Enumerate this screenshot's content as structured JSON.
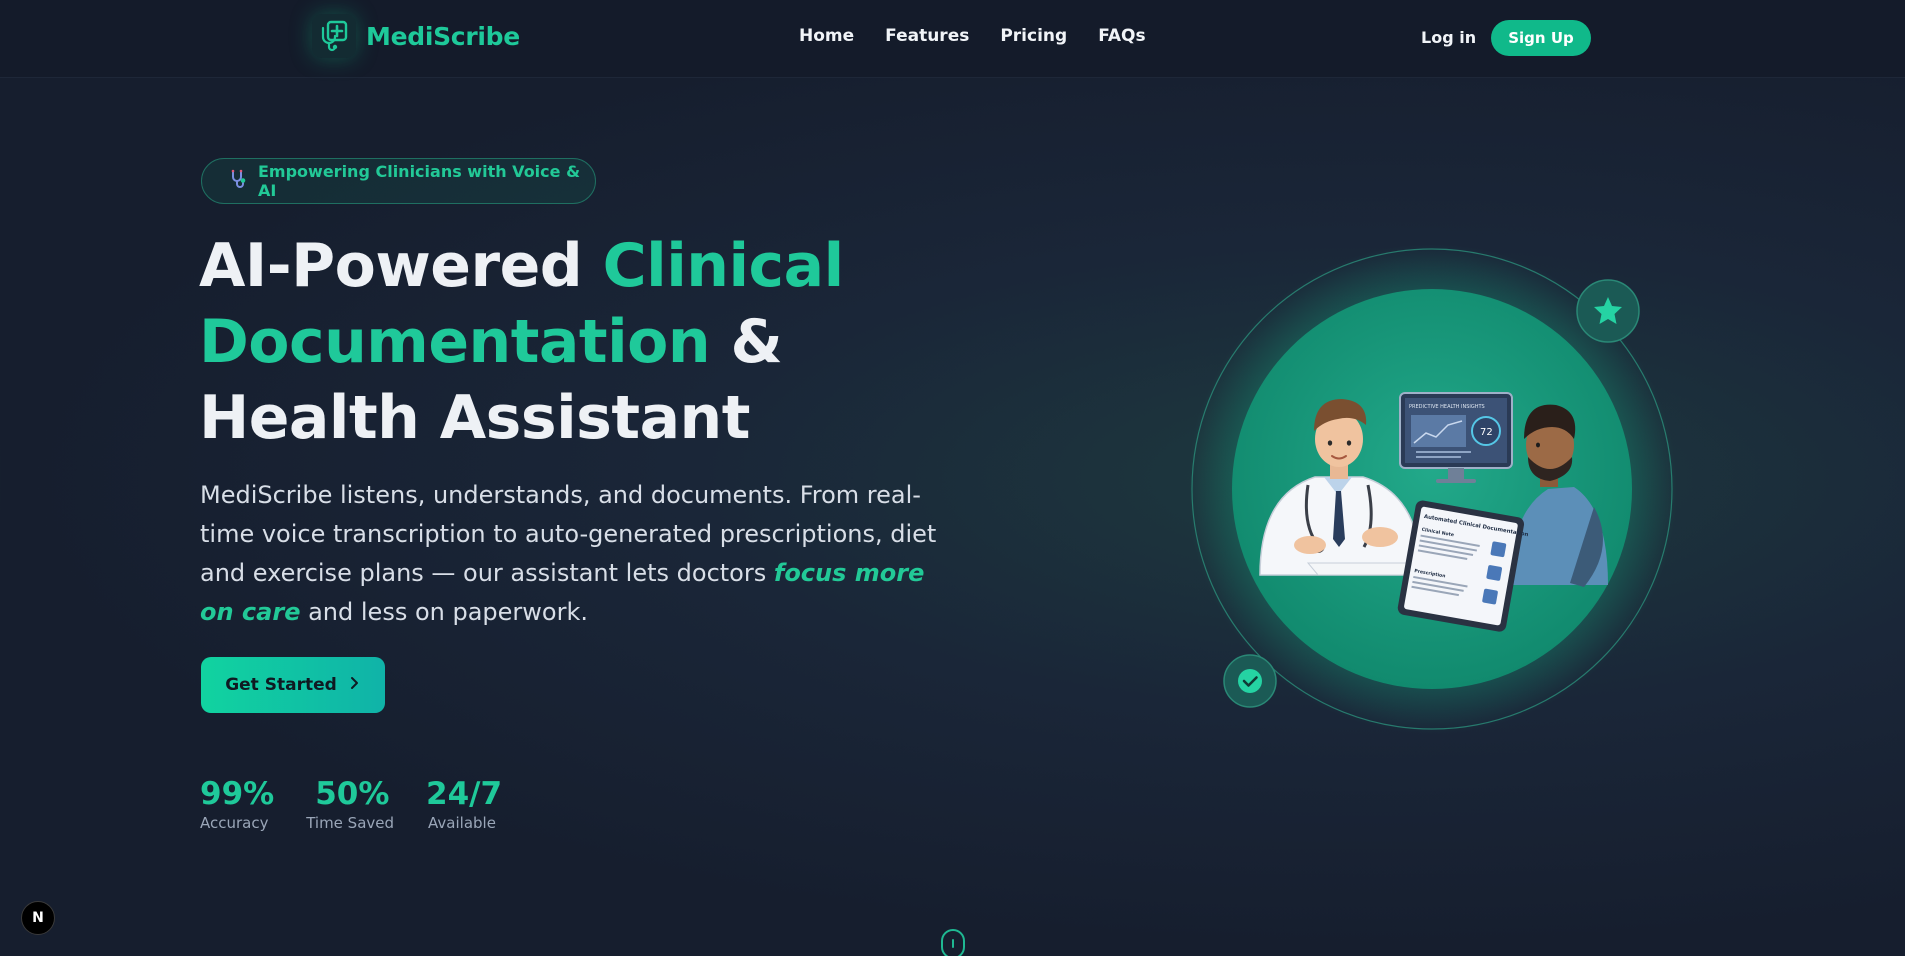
{
  "nav": {
    "brand": "MediScribe",
    "links": [
      "Home",
      "Features",
      "Pricing",
      "FAQs"
    ],
    "login": "Log in",
    "signup": "Sign Up"
  },
  "hero": {
    "badge": "Empowering Clinicians with Voice & AI",
    "headline": {
      "part1": "AI-Powered ",
      "accent1": "Clinical",
      "accent2": "Documentation",
      "part2": " &",
      "line3": "Health Assistant"
    },
    "lede": {
      "before": "MediScribe listens, understands, and documents. From real-time voice transcription to auto-generated prescriptions, diet and exercise plans — our assistant lets doctors ",
      "emphasis": "focus more on care",
      "after": " and less on paperwork."
    },
    "cta": "Get Started",
    "stats": [
      {
        "value": "99%",
        "label": "Accuracy"
      },
      {
        "value": "50%",
        "label": "Time Saved"
      },
      {
        "value": "24/7",
        "label": "Available"
      }
    ]
  },
  "illustration": {
    "screen_title": "PREDICTIVE HEALTH INSIGHTS",
    "gauge_value": "72",
    "tablet_title": "Automated Clinical Documentation",
    "tablet_section1": "Clinical Note",
    "tablet_section2": "Prescription"
  },
  "dev_badge": "N",
  "colors": {
    "accent": "#1fc99a",
    "button": "#10b98a",
    "background": "#18202f",
    "navbar": "#141b2a"
  }
}
